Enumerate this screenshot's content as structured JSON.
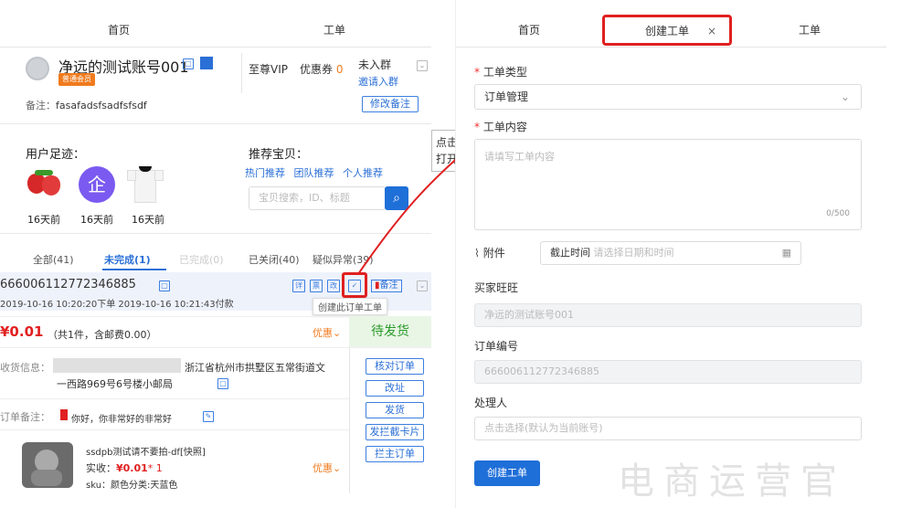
{
  "left": {
    "tabs": [
      "首页",
      "工单"
    ],
    "account": {
      "name": "净远的测试账号001",
      "member_badge": "普通会员",
      "vip": "至尊VIP",
      "coupon_label": "优惠券",
      "coupon_count": "0",
      "group_status": "未入群",
      "invite": "邀请入群",
      "remark_label": "备注：",
      "remark_value": "fasafadsfsadfsfsdf",
      "edit_remark": "修改备注"
    },
    "footprint": {
      "title": "用户足迹：",
      "items": [
        {
          "time": "16天前",
          "icon": "strawberry-image"
        },
        {
          "time": "16天前",
          "icon": "enterprise-icon"
        },
        {
          "time": "16天前",
          "icon": "tshirt-image"
        }
      ]
    },
    "recommend": {
      "title": "推荐宝贝：",
      "links": [
        "热门推荐",
        "团队推荐",
        "个人推荐"
      ],
      "search_placeholder": "宝贝搜索，ID、标题"
    },
    "order_tabs": [
      "全部(41)",
      "未完成(1)",
      "已完成(0)",
      "已关闭(40)",
      "疑似异常(39)"
    ],
    "order": {
      "id": "666006112772346885",
      "time": "2019-10-16 10:20:20下单 2019-10-16 10:21:43付款",
      "action_icons": [
        "详",
        "票",
        "改"
      ],
      "remark_btn": "备注",
      "tooltip": "创建此订单工单",
      "price": "¥0.01",
      "price_detail": "（共1件，含邮费0.00）",
      "promo": "优惠",
      "status": "待发货",
      "address_label": "收货信息：",
      "address_line1": "浙江省杭州市拱墅区五常街道文",
      "address_line2": "一西路969号6号楼小邮局",
      "side_buttons": [
        "核对订单",
        "改址",
        "发货",
        "发拦截卡片",
        "拦主订单"
      ],
      "remark_label": "订单备注：",
      "remark_text": "你好，你非常好的非常好",
      "product_name": "ssdpb测试请不要拍-df[快照]",
      "paid_label": "实收：",
      "paid_value": "¥0.01",
      "paid_qty": "* 1",
      "sku": "sku：颜色分类:天蓝色",
      "product_promo": "优惠"
    }
  },
  "callout": {
    "text": "点击打开"
  },
  "right": {
    "tabs": [
      "首页",
      "创建工单",
      "工单"
    ],
    "tab_close": "×",
    "type_label": "工单类型",
    "type_value": "订单管理",
    "content_label": "工单内容",
    "content_placeholder": "请填写工单内容",
    "content_count": "0/500",
    "attach_label": "附件",
    "deadline_label": "截止时间",
    "deadline_placeholder": "请选择日期和时间",
    "buyer_label": "买家旺旺",
    "buyer_value": "净远的测试账号001",
    "order_label": "订单编号",
    "order_value": "666006112772346885",
    "handler_label": "处理人",
    "handler_placeholder": "点击选择(默认为当前账号)",
    "submit": "创建工单"
  },
  "watermark": "电商运营官",
  "colors": {
    "accent": "#1f6fd8",
    "highlight": "#e02020",
    "pending": "#2a9a2a",
    "price": "#e02020"
  }
}
